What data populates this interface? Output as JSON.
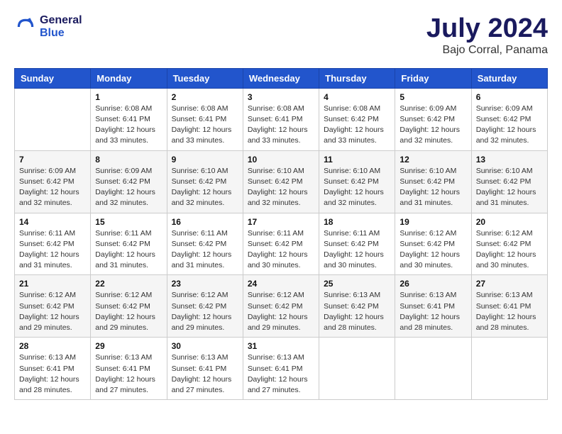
{
  "header": {
    "logo_line1": "General",
    "logo_line2": "Blue",
    "title": "July 2024",
    "subtitle": "Bajo Corral, Panama"
  },
  "weekdays": [
    "Sunday",
    "Monday",
    "Tuesday",
    "Wednesday",
    "Thursday",
    "Friday",
    "Saturday"
  ],
  "weeks": [
    [
      {
        "day": "",
        "sunrise": "",
        "sunset": "",
        "daylight": ""
      },
      {
        "day": "1",
        "sunrise": "Sunrise: 6:08 AM",
        "sunset": "Sunset: 6:41 PM",
        "daylight": "Daylight: 12 hours and 33 minutes."
      },
      {
        "day": "2",
        "sunrise": "Sunrise: 6:08 AM",
        "sunset": "Sunset: 6:41 PM",
        "daylight": "Daylight: 12 hours and 33 minutes."
      },
      {
        "day": "3",
        "sunrise": "Sunrise: 6:08 AM",
        "sunset": "Sunset: 6:41 PM",
        "daylight": "Daylight: 12 hours and 33 minutes."
      },
      {
        "day": "4",
        "sunrise": "Sunrise: 6:08 AM",
        "sunset": "Sunset: 6:42 PM",
        "daylight": "Daylight: 12 hours and 33 minutes."
      },
      {
        "day": "5",
        "sunrise": "Sunrise: 6:09 AM",
        "sunset": "Sunset: 6:42 PM",
        "daylight": "Daylight: 12 hours and 32 minutes."
      },
      {
        "day": "6",
        "sunrise": "Sunrise: 6:09 AM",
        "sunset": "Sunset: 6:42 PM",
        "daylight": "Daylight: 12 hours and 32 minutes."
      }
    ],
    [
      {
        "day": "7",
        "sunrise": "Sunrise: 6:09 AM",
        "sunset": "Sunset: 6:42 PM",
        "daylight": "Daylight: 12 hours and 32 minutes."
      },
      {
        "day": "8",
        "sunrise": "Sunrise: 6:09 AM",
        "sunset": "Sunset: 6:42 PM",
        "daylight": "Daylight: 12 hours and 32 minutes."
      },
      {
        "day": "9",
        "sunrise": "Sunrise: 6:10 AM",
        "sunset": "Sunset: 6:42 PM",
        "daylight": "Daylight: 12 hours and 32 minutes."
      },
      {
        "day": "10",
        "sunrise": "Sunrise: 6:10 AM",
        "sunset": "Sunset: 6:42 PM",
        "daylight": "Daylight: 12 hours and 32 minutes."
      },
      {
        "day": "11",
        "sunrise": "Sunrise: 6:10 AM",
        "sunset": "Sunset: 6:42 PM",
        "daylight": "Daylight: 12 hours and 32 minutes."
      },
      {
        "day": "12",
        "sunrise": "Sunrise: 6:10 AM",
        "sunset": "Sunset: 6:42 PM",
        "daylight": "Daylight: 12 hours and 31 minutes."
      },
      {
        "day": "13",
        "sunrise": "Sunrise: 6:10 AM",
        "sunset": "Sunset: 6:42 PM",
        "daylight": "Daylight: 12 hours and 31 minutes."
      }
    ],
    [
      {
        "day": "14",
        "sunrise": "Sunrise: 6:11 AM",
        "sunset": "Sunset: 6:42 PM",
        "daylight": "Daylight: 12 hours and 31 minutes."
      },
      {
        "day": "15",
        "sunrise": "Sunrise: 6:11 AM",
        "sunset": "Sunset: 6:42 PM",
        "daylight": "Daylight: 12 hours and 31 minutes."
      },
      {
        "day": "16",
        "sunrise": "Sunrise: 6:11 AM",
        "sunset": "Sunset: 6:42 PM",
        "daylight": "Daylight: 12 hours and 31 minutes."
      },
      {
        "day": "17",
        "sunrise": "Sunrise: 6:11 AM",
        "sunset": "Sunset: 6:42 PM",
        "daylight": "Daylight: 12 hours and 30 minutes."
      },
      {
        "day": "18",
        "sunrise": "Sunrise: 6:11 AM",
        "sunset": "Sunset: 6:42 PM",
        "daylight": "Daylight: 12 hours and 30 minutes."
      },
      {
        "day": "19",
        "sunrise": "Sunrise: 6:12 AM",
        "sunset": "Sunset: 6:42 PM",
        "daylight": "Daylight: 12 hours and 30 minutes."
      },
      {
        "day": "20",
        "sunrise": "Sunrise: 6:12 AM",
        "sunset": "Sunset: 6:42 PM",
        "daylight": "Daylight: 12 hours and 30 minutes."
      }
    ],
    [
      {
        "day": "21",
        "sunrise": "Sunrise: 6:12 AM",
        "sunset": "Sunset: 6:42 PM",
        "daylight": "Daylight: 12 hours and 29 minutes."
      },
      {
        "day": "22",
        "sunrise": "Sunrise: 6:12 AM",
        "sunset": "Sunset: 6:42 PM",
        "daylight": "Daylight: 12 hours and 29 minutes."
      },
      {
        "day": "23",
        "sunrise": "Sunrise: 6:12 AM",
        "sunset": "Sunset: 6:42 PM",
        "daylight": "Daylight: 12 hours and 29 minutes."
      },
      {
        "day": "24",
        "sunrise": "Sunrise: 6:12 AM",
        "sunset": "Sunset: 6:42 PM",
        "daylight": "Daylight: 12 hours and 29 minutes."
      },
      {
        "day": "25",
        "sunrise": "Sunrise: 6:13 AM",
        "sunset": "Sunset: 6:42 PM",
        "daylight": "Daylight: 12 hours and 28 minutes."
      },
      {
        "day": "26",
        "sunrise": "Sunrise: 6:13 AM",
        "sunset": "Sunset: 6:41 PM",
        "daylight": "Daylight: 12 hours and 28 minutes."
      },
      {
        "day": "27",
        "sunrise": "Sunrise: 6:13 AM",
        "sunset": "Sunset: 6:41 PM",
        "daylight": "Daylight: 12 hours and 28 minutes."
      }
    ],
    [
      {
        "day": "28",
        "sunrise": "Sunrise: 6:13 AM",
        "sunset": "Sunset: 6:41 PM",
        "daylight": "Daylight: 12 hours and 28 minutes."
      },
      {
        "day": "29",
        "sunrise": "Sunrise: 6:13 AM",
        "sunset": "Sunset: 6:41 PM",
        "daylight": "Daylight: 12 hours and 27 minutes."
      },
      {
        "day": "30",
        "sunrise": "Sunrise: 6:13 AM",
        "sunset": "Sunset: 6:41 PM",
        "daylight": "Daylight: 12 hours and 27 minutes."
      },
      {
        "day": "31",
        "sunrise": "Sunrise: 6:13 AM",
        "sunset": "Sunset: 6:41 PM",
        "daylight": "Daylight: 12 hours and 27 minutes."
      },
      {
        "day": "",
        "sunrise": "",
        "sunset": "",
        "daylight": ""
      },
      {
        "day": "",
        "sunrise": "",
        "sunset": "",
        "daylight": ""
      },
      {
        "day": "",
        "sunrise": "",
        "sunset": "",
        "daylight": ""
      }
    ]
  ]
}
